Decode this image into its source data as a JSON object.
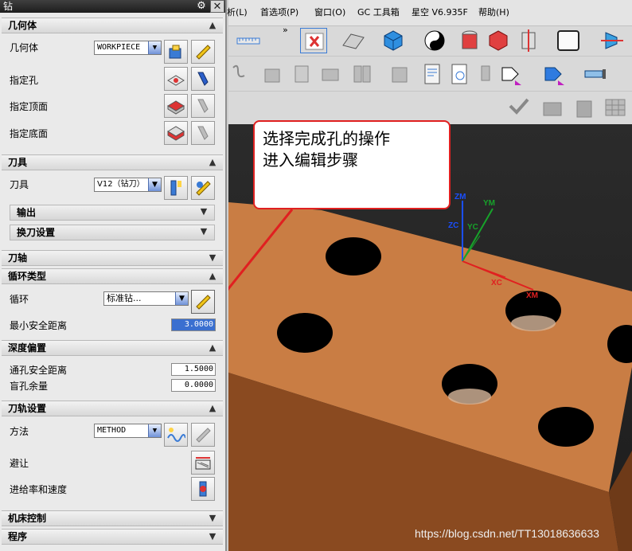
{
  "dialog": {
    "title": "钻",
    "sections": {
      "geometry": {
        "title": "几何体",
        "geometry_label": "几何体",
        "geometry_value": "WORKPIECE",
        "hole_label": "指定孔",
        "top_label": "指定顶面",
        "bottom_label": "指定底面"
      },
      "tool": {
        "title": "刀具",
        "tool_label": "刀具",
        "tool_value": "V12（钻刀）",
        "output_label": "输出",
        "tool_change_label": "换刀设置"
      },
      "axis": {
        "title": "刀轴"
      },
      "cycle": {
        "title": "循环类型",
        "cycle_label": "循环",
        "cycle_value": "标准钻...",
        "min_clearance_label": "最小安全距离",
        "min_clearance_value": "3.0000"
      },
      "depth_offset": {
        "title": "深度偏置",
        "through_clearance_label": "通孔安全距离",
        "through_clearance_value": "1.5000",
        "blind_stock_label": "盲孔余量",
        "blind_stock_value": "0.0000"
      },
      "path_settings": {
        "title": "刀轨设置",
        "method_label": "方法",
        "method_value": "METHOD",
        "avoidance_label": "避让",
        "feeds_label": "进给率和速度"
      },
      "machine_control": {
        "title": "机床控制"
      },
      "program": {
        "title": "程序"
      }
    }
  },
  "menubar": {
    "items": [
      "析(L)",
      "首选项(P)",
      "窗口(O)",
      "GC 工具箱",
      "星空 V6.935F",
      "帮助(H)"
    ]
  },
  "callout": {
    "line1": "选择完成孔的操作",
    "line2": "进入编辑步骤"
  },
  "viewport": {
    "axes": {
      "zm": "ZM",
      "ym": "YM",
      "zc": "ZC",
      "yc": "YC",
      "xc": "XC",
      "xm": "XM"
    }
  },
  "watermark": "https://blog.csdn.net/TT13018636633",
  "colors": {
    "part": "#c97d44",
    "background": "#242424",
    "callout_border": "#e02020",
    "arrow": "#e02020"
  }
}
